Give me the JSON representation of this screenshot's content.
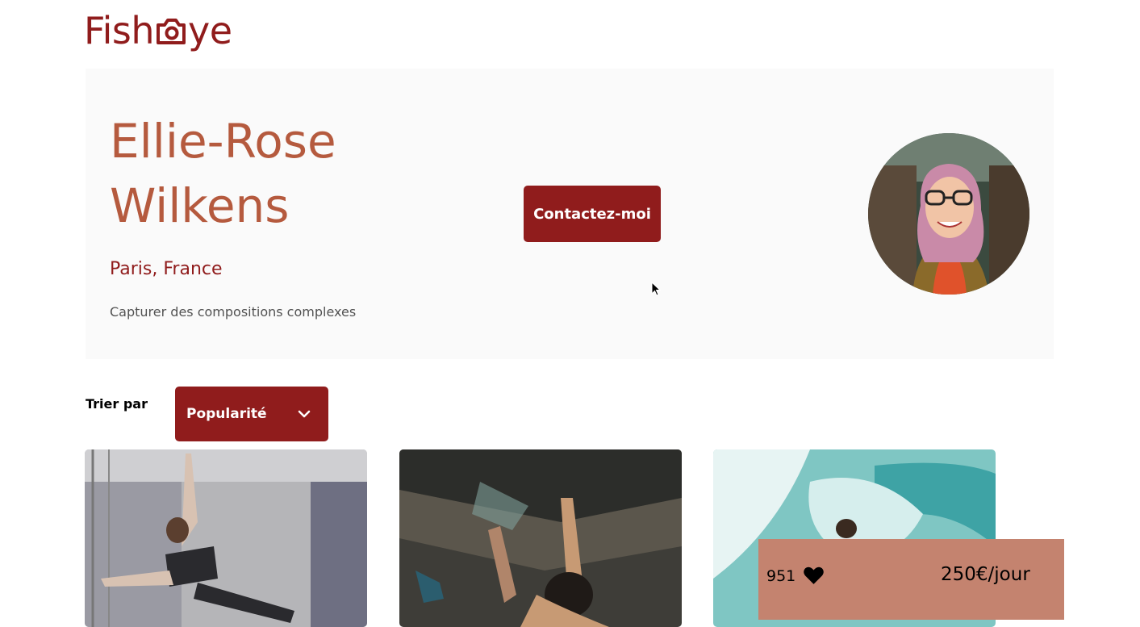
{
  "brand": {
    "logo_text_start": "Fish",
    "logo_text_end": "ye",
    "logo_icon": "camera-icon"
  },
  "photographer": {
    "name": "Ellie-Rose Wilkens",
    "location": "Paris, France",
    "tagline": "Capturer des compositions complexes",
    "contact_label": "Contactez-moi",
    "avatar_icon": "avatar-portrait"
  },
  "sort": {
    "label": "Trier par",
    "selected": "Popularité",
    "icon": "chevron-down-icon"
  },
  "stats": {
    "likes": "951",
    "price": "250€/jour",
    "icon": "heart-icon"
  },
  "colors": {
    "primary": "#901C1C",
    "accent": "#D3573C",
    "name_color": "#B55A3E",
    "header_bg": "#FAFAFA",
    "stats_bg": "#C4836F"
  }
}
